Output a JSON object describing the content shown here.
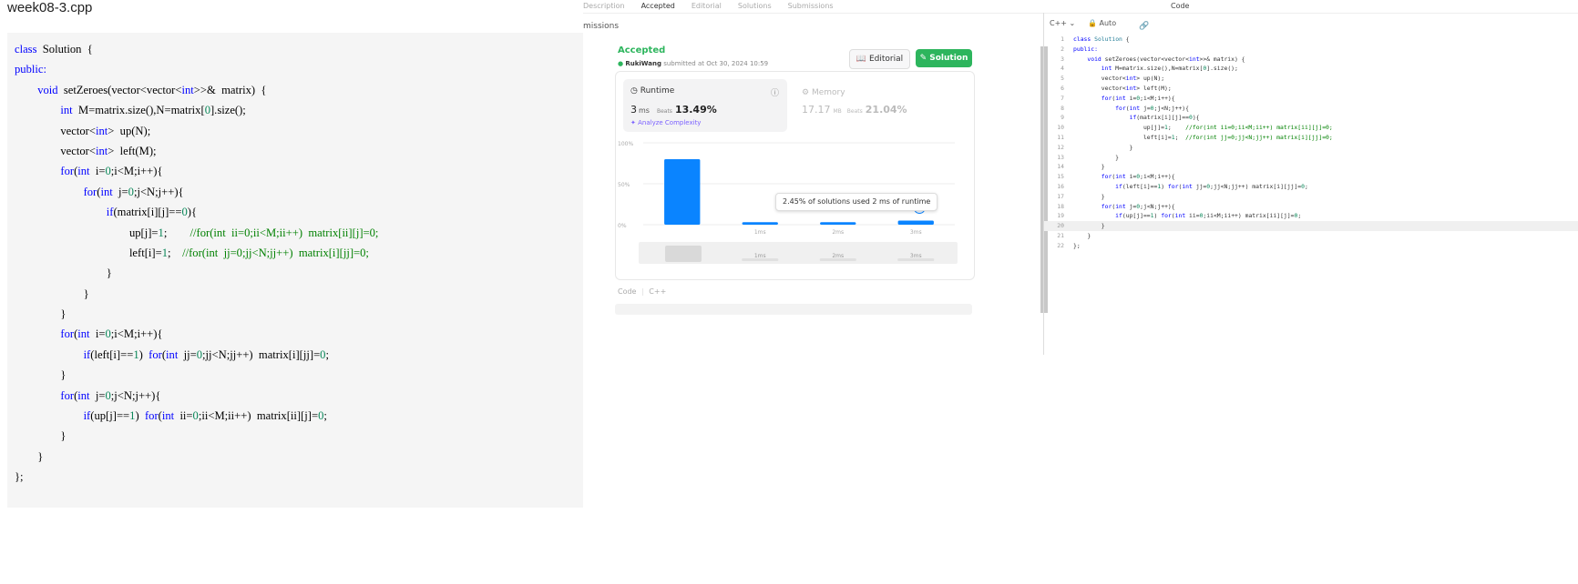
{
  "file_title": "week08-3.cpp",
  "left_code": [
    [
      {
        "t": "class",
        "c": "kw"
      },
      {
        "t": "  Solution  {"
      }
    ],
    [
      {
        "t": "public:",
        "c": "kw"
      }
    ],
    [
      {
        "t": "        "
      },
      {
        "t": "void",
        "c": "kw"
      },
      {
        "t": "  setZeroes(vector<vector<"
      },
      {
        "t": "int",
        "c": "kw"
      },
      {
        "t": ">>&  matrix)  {"
      }
    ],
    [
      {
        "t": "                "
      },
      {
        "t": "int",
        "c": "kw"
      },
      {
        "t": "  M=matrix.size(),N=matrix["
      },
      {
        "t": "0",
        "c": "num"
      },
      {
        "t": "].size();"
      }
    ],
    [
      {
        "t": "                vector<"
      },
      {
        "t": "int",
        "c": "kw"
      },
      {
        "t": ">  up(N);"
      }
    ],
    [
      {
        "t": "                vector<"
      },
      {
        "t": "int",
        "c": "kw"
      },
      {
        "t": ">  left(M);"
      }
    ],
    [
      {
        "t": "                "
      },
      {
        "t": "for",
        "c": "kw"
      },
      {
        "t": "("
      },
      {
        "t": "int",
        "c": "kw"
      },
      {
        "t": "  i="
      },
      {
        "t": "0",
        "c": "num"
      },
      {
        "t": ";i<M;i++){"
      }
    ],
    [
      {
        "t": "                        "
      },
      {
        "t": "for",
        "c": "kw"
      },
      {
        "t": "("
      },
      {
        "t": "int",
        "c": "kw"
      },
      {
        "t": "  j="
      },
      {
        "t": "0",
        "c": "num"
      },
      {
        "t": ";j<N;j++){"
      }
    ],
    [
      {
        "t": "                                "
      },
      {
        "t": "if",
        "c": "kw"
      },
      {
        "t": "(matrix[i][j]=="
      },
      {
        "t": "0",
        "c": "num"
      },
      {
        "t": "){"
      }
    ],
    [
      {
        "t": "                                        up[j]="
      },
      {
        "t": "1",
        "c": "num"
      },
      {
        "t": ";        "
      },
      {
        "t": "//for(int  ii=0;ii<M;ii++)  matrix[ii][j]=0;",
        "c": "cm"
      }
    ],
    [
      {
        "t": "                                        left[i]="
      },
      {
        "t": "1",
        "c": "num"
      },
      {
        "t": ";    "
      },
      {
        "t": "//for(int  jj=0;jj<N;jj++)  matrix[i][jj]=0;",
        "c": "cm"
      }
    ],
    [
      {
        "t": "                                }"
      }
    ],
    [
      {
        "t": "                        }"
      }
    ],
    [
      {
        "t": "                }"
      }
    ],
    [
      {
        "t": "                "
      },
      {
        "t": "for",
        "c": "kw"
      },
      {
        "t": "("
      },
      {
        "t": "int",
        "c": "kw"
      },
      {
        "t": "  i="
      },
      {
        "t": "0",
        "c": "num"
      },
      {
        "t": ";i<M;i++){"
      }
    ],
    [
      {
        "t": "                        "
      },
      {
        "t": "if",
        "c": "kw"
      },
      {
        "t": "(left[i]=="
      },
      {
        "t": "1",
        "c": "num"
      },
      {
        "t": ")  "
      },
      {
        "t": "for",
        "c": "kw"
      },
      {
        "t": "("
      },
      {
        "t": "int",
        "c": "kw"
      },
      {
        "t": "  jj="
      },
      {
        "t": "0",
        "c": "num"
      },
      {
        "t": ";jj<N;jj++)  matrix[i][jj]="
      },
      {
        "t": "0",
        "c": "num"
      },
      {
        "t": ";"
      }
    ],
    [
      {
        "t": "                }"
      }
    ],
    [
      {
        "t": "                "
      },
      {
        "t": "for",
        "c": "kw"
      },
      {
        "t": "("
      },
      {
        "t": "int",
        "c": "kw"
      },
      {
        "t": "  j="
      },
      {
        "t": "0",
        "c": "num"
      },
      {
        "t": ";j<N;j++){"
      }
    ],
    [
      {
        "t": "                        "
      },
      {
        "t": "if",
        "c": "kw"
      },
      {
        "t": "(up[j]=="
      },
      {
        "t": "1",
        "c": "num"
      },
      {
        "t": ")  "
      },
      {
        "t": "for",
        "c": "kw"
      },
      {
        "t": "("
      },
      {
        "t": "int",
        "c": "kw"
      },
      {
        "t": "  ii="
      },
      {
        "t": "0",
        "c": "num"
      },
      {
        "t": ";ii<M;ii++)  matrix[ii][j]="
      },
      {
        "t": "0",
        "c": "num"
      },
      {
        "t": ";"
      }
    ],
    [
      {
        "t": "                }"
      }
    ],
    [
      {
        "t": "        }"
      }
    ],
    [
      {
        "t": "};"
      }
    ]
  ],
  "leetcode": {
    "top_tabs": [
      "Description",
      "Accepted",
      "Editorial",
      "Solutions",
      "Submissions"
    ],
    "code_tab": "Code",
    "sub_header": "missions",
    "status": "Accepted",
    "author": "RukiWang",
    "submitted": "submitted at Oct 30, 2024 10:59",
    "editorial_label": "Editorial",
    "solution_label": "Solution",
    "runtime": {
      "label": "Runtime",
      "value": "3",
      "unit": "ms",
      "beats_label": "Beats",
      "beats": "13.49%",
      "analyze": "Analyze Complexity"
    },
    "memory": {
      "label": "Memory",
      "value": "17.17",
      "unit": "MB",
      "beats_label": "Beats",
      "beats": "21.04%"
    },
    "tooltip": "2.45% of solutions used 2 ms of runtime",
    "code_label": "Code",
    "code_lang": "C++",
    "editor_lang": "C++",
    "editor_mode": "Auto",
    "editor_lines": [
      [
        {
          "t": "class",
          "c": "kw2"
        },
        {
          "t": " "
        },
        {
          "t": "Solution",
          "c": "ty"
        },
        {
          "t": " {"
        }
      ],
      [
        {
          "t": "public:",
          "c": "kw2"
        }
      ],
      [
        {
          "t": "    "
        },
        {
          "t": "void",
          "c": "kw2"
        },
        {
          "t": " setZeroes(vector<vector<"
        },
        {
          "t": "int",
          "c": "kw2"
        },
        {
          "t": ">>& matrix) {"
        }
      ],
      [
        {
          "t": "        "
        },
        {
          "t": "int",
          "c": "kw2"
        },
        {
          "t": " M=matrix.size(),N=matrix["
        },
        {
          "t": "0",
          "c": "nm"
        },
        {
          "t": "].size();"
        }
      ],
      [
        {
          "t": "        vector<"
        },
        {
          "t": "int",
          "c": "kw2"
        },
        {
          "t": "> up(N);"
        }
      ],
      [
        {
          "t": "        vector<"
        },
        {
          "t": "int",
          "c": "kw2"
        },
        {
          "t": "> left(M);"
        }
      ],
      [
        {
          "t": "        "
        },
        {
          "t": "for",
          "c": "kw2"
        },
        {
          "t": "("
        },
        {
          "t": "int",
          "c": "kw2"
        },
        {
          "t": " i="
        },
        {
          "t": "0",
          "c": "nm"
        },
        {
          "t": ";i<M;i++){"
        }
      ],
      [
        {
          "t": "            "
        },
        {
          "t": "for",
          "c": "kw2"
        },
        {
          "t": "("
        },
        {
          "t": "int",
          "c": "kw2"
        },
        {
          "t": " j="
        },
        {
          "t": "0",
          "c": "nm"
        },
        {
          "t": ";j<N;j++){"
        }
      ],
      [
        {
          "t": "                "
        },
        {
          "t": "if",
          "c": "kw2"
        },
        {
          "t": "(matrix[i][j]=="
        },
        {
          "t": "0",
          "c": "nm"
        },
        {
          "t": "){"
        }
      ],
      [
        {
          "t": "                    up[j]="
        },
        {
          "t": "1",
          "c": "nm"
        },
        {
          "t": ";    "
        },
        {
          "t": "//for(int ii=0;ii<M;ii++) matrix[ii][j]=0;",
          "c": "cm2"
        }
      ],
      [
        {
          "t": "                    left[i]="
        },
        {
          "t": "1",
          "c": "nm"
        },
        {
          "t": ";  "
        },
        {
          "t": "//for(int jj=0;jj<N;jj++) matrix[i][jj]=0;",
          "c": "cm2"
        }
      ],
      [
        {
          "t": "                }"
        }
      ],
      [
        {
          "t": "            }"
        }
      ],
      [
        {
          "t": "        }"
        }
      ],
      [
        {
          "t": "        "
        },
        {
          "t": "for",
          "c": "kw2"
        },
        {
          "t": "("
        },
        {
          "t": "int",
          "c": "kw2"
        },
        {
          "t": " i="
        },
        {
          "t": "0",
          "c": "nm"
        },
        {
          "t": ";i<M;i++){"
        }
      ],
      [
        {
          "t": "            "
        },
        {
          "t": "if",
          "c": "kw2"
        },
        {
          "t": "(left[i]=="
        },
        {
          "t": "1",
          "c": "nm"
        },
        {
          "t": ") "
        },
        {
          "t": "for",
          "c": "kw2"
        },
        {
          "t": "("
        },
        {
          "t": "int",
          "c": "kw2"
        },
        {
          "t": " jj="
        },
        {
          "t": "0",
          "c": "nm"
        },
        {
          "t": ";jj<N;jj++) matrix[i][jj]="
        },
        {
          "t": "0",
          "c": "nm"
        },
        {
          "t": ";"
        }
      ],
      [
        {
          "t": "        }"
        }
      ],
      [
        {
          "t": "        "
        },
        {
          "t": "for",
          "c": "kw2"
        },
        {
          "t": "("
        },
        {
          "t": "int",
          "c": "kw2"
        },
        {
          "t": " j="
        },
        {
          "t": "0",
          "c": "nm"
        },
        {
          "t": ";j<N;j++){"
        }
      ],
      [
        {
          "t": "            "
        },
        {
          "t": "if",
          "c": "kw2"
        },
        {
          "t": "(up[j]=="
        },
        {
          "t": "1",
          "c": "nm"
        },
        {
          "t": ") "
        },
        {
          "t": "for",
          "c": "kw2"
        },
        {
          "t": "("
        },
        {
          "t": "int",
          "c": "kw2"
        },
        {
          "t": " ii="
        },
        {
          "t": "0",
          "c": "nm"
        },
        {
          "t": ";ii<M;ii++) matrix[ii][j]="
        },
        {
          "t": "0",
          "c": "nm"
        },
        {
          "t": ";"
        }
      ],
      [
        {
          "t": "        }"
        }
      ],
      [
        {
          "t": "    }"
        }
      ],
      [
        {
          "t": "};"
        }
      ]
    ],
    "current_line": 20,
    "colors": {
      "accepted": "#2db55d",
      "bar": "#0a84ff",
      "keyword": "#0000ff",
      "comment": "#008000",
      "number": "#098658"
    }
  },
  "chart_data": {
    "type": "bar",
    "categories": [
      "",
      "1ms",
      "2ms",
      "3ms"
    ],
    "values": [
      80,
      3,
      3,
      5
    ],
    "highlight_index": 3,
    "ylim": [
      0,
      100
    ],
    "ytick_labels": [
      "0%",
      "50%",
      "100%"
    ],
    "xlabel": "",
    "ylabel": "",
    "minimap_labels": [
      "1ms",
      "2ms",
      "3ms"
    ],
    "grid": true
  }
}
